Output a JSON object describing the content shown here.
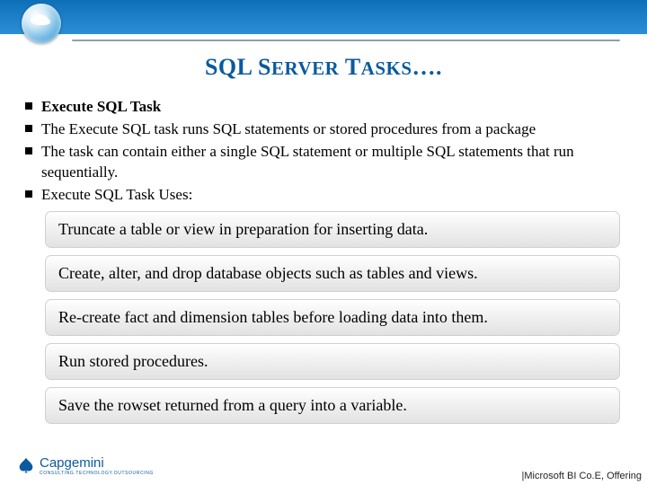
{
  "title": {
    "t1": "SQL S",
    "t2": "ERVER",
    "t3": " T",
    "t4": "ASKS",
    "t5": "…."
  },
  "bullets": [
    "Execute SQL Task",
    "The Execute SQL task runs SQL statements or stored procedures from a package",
    " The task can contain either a single SQL statement or multiple SQL statements that run sequentially.",
    "Execute SQL Task Uses:"
  ],
  "boxes": [
    "Truncate a table or view in preparation for inserting data.",
    "Create, alter, and drop database objects such as tables and views.",
    "Re-create fact and dimension tables before loading data into them.",
    "Run stored procedures.",
    "Save the rowset returned from a query into a variable."
  ],
  "footer": "|Microsoft BI Co.E, Offering",
  "logo": {
    "name": "Capgemini",
    "tagline": "CONSULTING.TECHNOLOGY.OUTSOURCING"
  }
}
